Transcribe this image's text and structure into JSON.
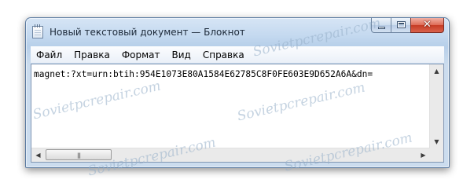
{
  "window": {
    "title": "Новый текстовый документ — Блокнот",
    "app_icon": "notepad-icon",
    "caption_buttons": {
      "minimize_icon": "minimize-icon",
      "maximize_icon": "maximize-icon",
      "close_icon": "close-icon",
      "close_glyph": "✕"
    }
  },
  "menubar": {
    "items": [
      {
        "label": "Файл"
      },
      {
        "label": "Правка"
      },
      {
        "label": "Формат"
      },
      {
        "label": "Вид"
      },
      {
        "label": "Справка"
      }
    ]
  },
  "editor": {
    "content": "magnet:?xt=urn:btih:954E1073E80A1584E62785C8F0FE603E9D652A6A&dn=",
    "scroll_up_glyph": "▲",
    "scroll_down_glyph": "▼",
    "scroll_left_glyph": "◀",
    "scroll_right_glyph": "▶",
    "thumb_grip": "|||"
  },
  "watermark": {
    "text": "Sovietpcrepair.com"
  },
  "colors": {
    "frame": "#c3d8ef",
    "close_button": "#c63b24",
    "menu_bg": "#eaf0f8"
  }
}
